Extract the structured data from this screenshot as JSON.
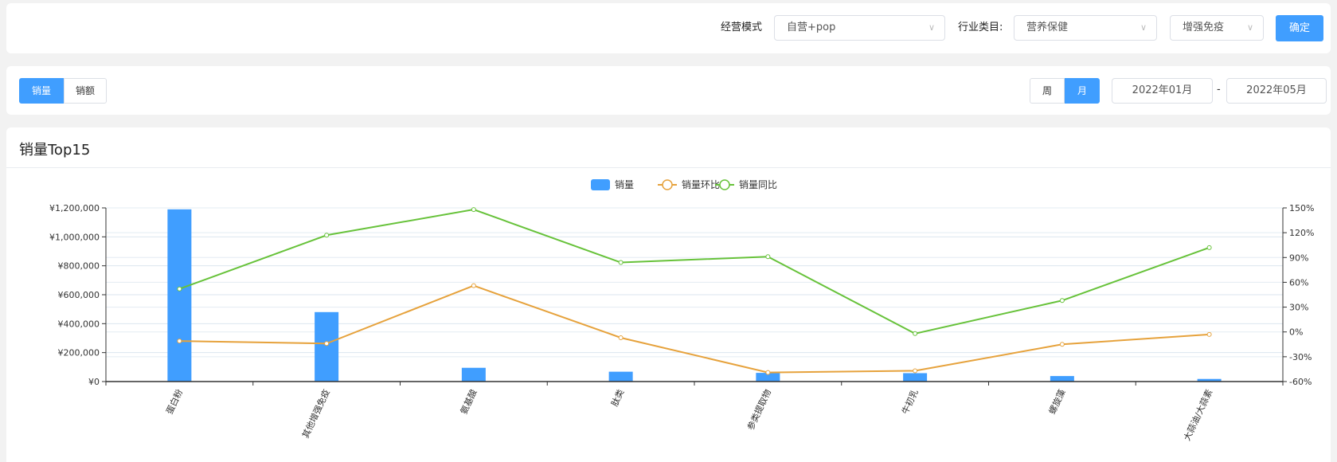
{
  "filters": {
    "mode_label": "经营模式",
    "mode_value": "自营+pop",
    "industry_label": "行业类目:",
    "industry_value": "营养保健",
    "sub_value": "增强免疫",
    "confirm": "确定"
  },
  "toolbar": {
    "metric_tabs": [
      "销量",
      "销额"
    ],
    "period_tabs": [
      "周",
      "月"
    ],
    "date_start": "2022年01月",
    "date_sep": "-",
    "date_end": "2022年05月"
  },
  "chart_title": "销量Top15",
  "colors": {
    "bar": "#409eff",
    "mom": "#e6a23c",
    "yoy": "#67c23a"
  },
  "chart_data": {
    "type": "bar",
    "title": "销量Top15",
    "categories": [
      "蛋白粉",
      "其他增强免疫",
      "氨基酸",
      "肽类",
      "参类提取物",
      "牛初乳",
      "螺旋藻",
      "大蒜油/大蒜素"
    ],
    "series": [
      {
        "name": "销量",
        "type": "bar",
        "axis": "left",
        "values": [
          1190000,
          480000,
          95000,
          68000,
          60000,
          58000,
          38000,
          18000
        ]
      },
      {
        "name": "销量环比",
        "type": "line",
        "axis": "right",
        "values": [
          -11,
          -14,
          56,
          -7,
          -49,
          -47,
          -15,
          -3
        ]
      },
      {
        "name": "销量同比",
        "type": "line",
        "axis": "right",
        "values": [
          52,
          117,
          148,
          84,
          91,
          -2,
          38,
          102
        ]
      }
    ],
    "left_axis": {
      "ylim": [
        0,
        1200000
      ],
      "ticks": [
        "¥0",
        "¥200,000",
        "¥400,000",
        "¥600,000",
        "¥800,000",
        "¥1,000,000",
        "¥1,200,000"
      ]
    },
    "right_axis": {
      "ylim": [
        -60,
        150
      ],
      "ticks": [
        "-60%",
        "-30%",
        "0%",
        "30%",
        "60%",
        "90%",
        "120%",
        "150%"
      ]
    },
    "legend": {
      "position": "top-center",
      "items": [
        "销量",
        "销量环比",
        "销量同比"
      ]
    }
  }
}
